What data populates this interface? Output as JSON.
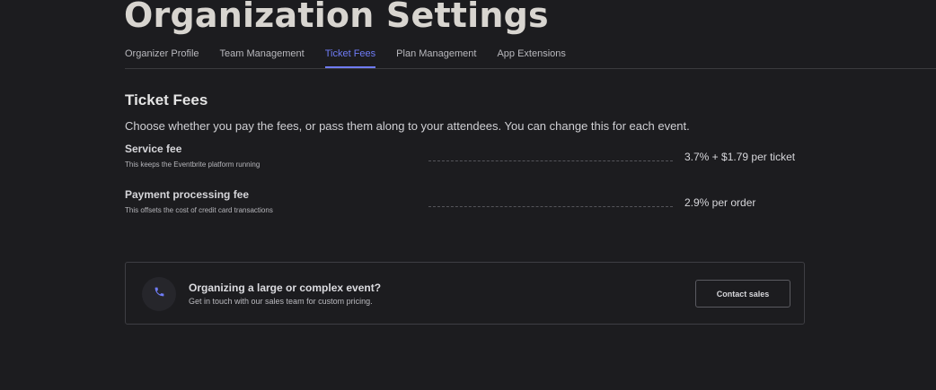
{
  "header": {
    "title": "Organization Settings"
  },
  "tabs": [
    {
      "label": "Organizer Profile",
      "active": false
    },
    {
      "label": "Team Management",
      "active": false
    },
    {
      "label": "Ticket Fees",
      "active": true
    },
    {
      "label": "Plan Management",
      "active": false
    },
    {
      "label": "App Extensions",
      "active": false
    }
  ],
  "ticket_fees": {
    "title": "Ticket Fees",
    "description": "Choose whether you pay the fees, or pass them along to your attendees. You can change this for each event.",
    "fees": [
      {
        "name": "Service fee",
        "subtitle": "This keeps the Eventbrite platform running",
        "value": "3.7% + $1.79 per ticket"
      },
      {
        "name": "Payment processing fee",
        "subtitle": "This offsets the cost of credit card transactions",
        "value": "2.9% per order"
      }
    ]
  },
  "sales_card": {
    "icon": "phone-icon",
    "title": "Organizing a large or complex event?",
    "subtitle": "Get in touch with our sales team for custom pricing.",
    "button_label": "Contact sales"
  },
  "colors": {
    "background": "#1c1c1f",
    "accent": "#6f7cf7",
    "border": "#3e3e43"
  }
}
